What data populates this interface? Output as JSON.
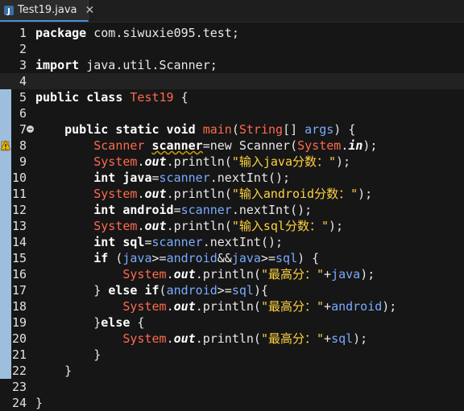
{
  "tab": {
    "title": "Test19.java",
    "close": "✕",
    "icon": "java-file-icon"
  },
  "colors": {
    "background": "#161616",
    "keyword": "#ffffff",
    "type": "#ff6a4d",
    "string": "#ffd23f",
    "field_ref": "#79abff",
    "ruler": "#9ebede"
  },
  "lines": [
    {
      "n": "1",
      "segs": [
        [
          "kw",
          "package"
        ],
        [
          "plain",
          " com.siwuxie095.test;"
        ]
      ]
    },
    {
      "n": "2",
      "segs": []
    },
    {
      "n": "3",
      "segs": [
        [
          "kw",
          "import"
        ],
        [
          "plain",
          " java.util.Scanner;"
        ]
      ]
    },
    {
      "n": "4",
      "segs": [],
      "current": true
    },
    {
      "n": "5",
      "segs": [
        [
          "kw",
          "public class"
        ],
        [
          "plain",
          " "
        ],
        [
          "tname",
          "Test19"
        ],
        [
          "plain",
          " {"
        ]
      ]
    },
    {
      "n": "6",
      "segs": []
    },
    {
      "n": "7",
      "fold": true,
      "segs": [
        [
          "plain",
          "    "
        ],
        [
          "kw",
          "public static void"
        ],
        [
          "plain",
          " "
        ],
        [
          "fn",
          "main"
        ],
        [
          "plain",
          "("
        ],
        [
          "type",
          "String"
        ],
        [
          "plain",
          "[] "
        ],
        [
          "ref",
          "args"
        ],
        [
          "plain",
          ") {"
        ]
      ]
    },
    {
      "n": "8",
      "warn": true,
      "segs": [
        [
          "plain",
          "        "
        ],
        [
          "type",
          "Scanner"
        ],
        [
          "plain",
          " "
        ],
        [
          "varsq",
          "scanner"
        ],
        [
          "plain",
          "=new Scanner("
        ],
        [
          "type",
          "System"
        ],
        [
          "plain",
          "."
        ],
        [
          "out",
          "in"
        ],
        [
          "plain",
          ");"
        ]
      ]
    },
    {
      "n": "9",
      "segs": [
        [
          "plain",
          "        "
        ],
        [
          "type",
          "System"
        ],
        [
          "plain",
          "."
        ],
        [
          "out",
          "out"
        ],
        [
          "plain",
          ".println("
        ],
        [
          "str",
          "\"输入java分数：\""
        ],
        [
          "plain",
          ");"
        ]
      ]
    },
    {
      "n": "10",
      "segs": [
        [
          "plain",
          "        "
        ],
        [
          "kw",
          "int"
        ],
        [
          "plain",
          " "
        ],
        [
          "var",
          "java"
        ],
        [
          "plain",
          "="
        ],
        [
          "ref",
          "scanner"
        ],
        [
          "plain",
          ".nextInt();"
        ]
      ]
    },
    {
      "n": "11",
      "segs": [
        [
          "plain",
          "        "
        ],
        [
          "type",
          "System"
        ],
        [
          "plain",
          "."
        ],
        [
          "out",
          "out"
        ],
        [
          "plain",
          ".println("
        ],
        [
          "str",
          "\"输入android分数：\""
        ],
        [
          "plain",
          ");"
        ]
      ]
    },
    {
      "n": "12",
      "segs": [
        [
          "plain",
          "        "
        ],
        [
          "kw",
          "int"
        ],
        [
          "plain",
          " "
        ],
        [
          "var",
          "android"
        ],
        [
          "plain",
          "="
        ],
        [
          "ref",
          "scanner"
        ],
        [
          "plain",
          ".nextInt();"
        ]
      ]
    },
    {
      "n": "13",
      "segs": [
        [
          "plain",
          "        "
        ],
        [
          "type",
          "System"
        ],
        [
          "plain",
          "."
        ],
        [
          "out",
          "out"
        ],
        [
          "plain",
          ".println("
        ],
        [
          "str",
          "\"输入sql分数：\""
        ],
        [
          "plain",
          ");"
        ]
      ]
    },
    {
      "n": "14",
      "segs": [
        [
          "plain",
          "        "
        ],
        [
          "kw",
          "int"
        ],
        [
          "plain",
          " "
        ],
        [
          "var",
          "sql"
        ],
        [
          "plain",
          "="
        ],
        [
          "ref",
          "scanner"
        ],
        [
          "plain",
          ".nextInt();"
        ]
      ]
    },
    {
      "n": "15",
      "segs": [
        [
          "plain",
          "        "
        ],
        [
          "kw",
          "if"
        ],
        [
          "plain",
          " ("
        ],
        [
          "ref",
          "java"
        ],
        [
          "plain",
          ">="
        ],
        [
          "ref",
          "android"
        ],
        [
          "plain",
          "&&"
        ],
        [
          "ref",
          "java"
        ],
        [
          "plain",
          ">="
        ],
        [
          "ref",
          "sql"
        ],
        [
          "plain",
          ") {"
        ]
      ]
    },
    {
      "n": "16",
      "segs": [
        [
          "plain",
          "            "
        ],
        [
          "type",
          "System"
        ],
        [
          "plain",
          "."
        ],
        [
          "out",
          "out"
        ],
        [
          "plain",
          ".println("
        ],
        [
          "str",
          "\"最高分：\""
        ],
        [
          "plain",
          "+"
        ],
        [
          "ref",
          "java"
        ],
        [
          "plain",
          ");"
        ]
      ]
    },
    {
      "n": "17",
      "segs": [
        [
          "plain",
          "        } "
        ],
        [
          "kw",
          "else if"
        ],
        [
          "plain",
          "("
        ],
        [
          "ref",
          "android"
        ],
        [
          "plain",
          ">="
        ],
        [
          "ref",
          "sql"
        ],
        [
          "plain",
          "){"
        ]
      ]
    },
    {
      "n": "18",
      "segs": [
        [
          "plain",
          "            "
        ],
        [
          "type",
          "System"
        ],
        [
          "plain",
          "."
        ],
        [
          "out",
          "out"
        ],
        [
          "plain",
          ".println("
        ],
        [
          "str",
          "\"最高分：\""
        ],
        [
          "plain",
          "+"
        ],
        [
          "ref",
          "android"
        ],
        [
          "plain",
          ");"
        ]
      ]
    },
    {
      "n": "19",
      "segs": [
        [
          "plain",
          "        }"
        ],
        [
          "kw",
          "else"
        ],
        [
          "plain",
          " {"
        ]
      ]
    },
    {
      "n": "20",
      "segs": [
        [
          "plain",
          "            "
        ],
        [
          "type",
          "System"
        ],
        [
          "plain",
          "."
        ],
        [
          "out",
          "out"
        ],
        [
          "plain",
          ".println("
        ],
        [
          "str",
          "\"最高分：\""
        ],
        [
          "plain",
          "+"
        ],
        [
          "ref",
          "sql"
        ],
        [
          "plain",
          ");"
        ]
      ]
    },
    {
      "n": "21",
      "segs": [
        [
          "plain",
          "        }"
        ]
      ]
    },
    {
      "n": "22",
      "segs": [
        [
          "plain",
          "    }"
        ]
      ]
    },
    {
      "n": "23",
      "segs": []
    },
    {
      "n": "24",
      "segs": [
        [
          "plain",
          "}"
        ]
      ]
    }
  ]
}
